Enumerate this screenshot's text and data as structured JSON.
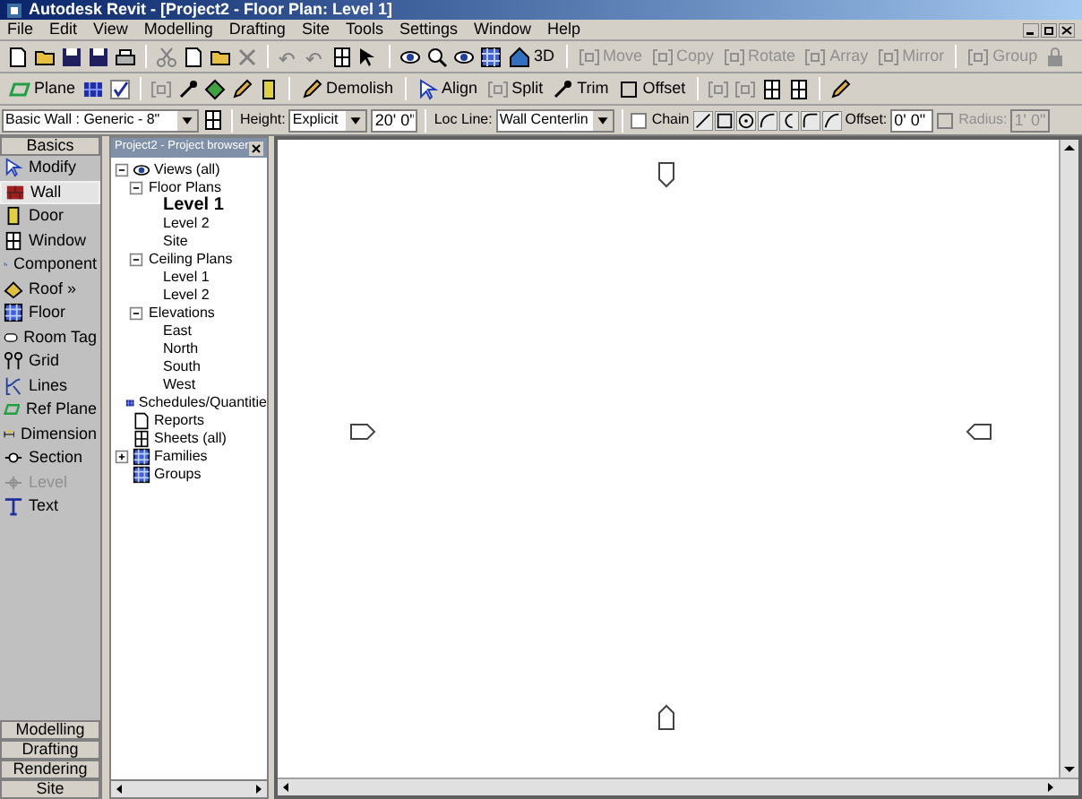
{
  "window": {
    "title": "Autodesk Revit - [Project2 - Floor Plan: Level 1]"
  },
  "menu": [
    "File",
    "Edit",
    "View",
    "Modelling",
    "Drafting",
    "Site",
    "Tools",
    "Settings",
    "Window",
    "Help"
  ],
  "toolbar_1": [
    {
      "label": "3D",
      "disabled": false
    },
    {
      "label": "Move",
      "disabled": true
    },
    {
      "label": "Copy",
      "disabled": true
    },
    {
      "label": "Rotate",
      "disabled": true
    },
    {
      "label": "Array",
      "disabled": true
    },
    {
      "label": "Mirror",
      "disabled": true
    },
    {
      "label": "Group",
      "disabled": true
    }
  ],
  "toolbar_2": [
    {
      "label": "Plane"
    },
    {
      "label": "Demolish"
    },
    {
      "label": "Align"
    },
    {
      "label": "Split"
    },
    {
      "label": "Trim"
    },
    {
      "label": "Offset"
    }
  ],
  "options_bar": {
    "type": "Basic Wall : Generic - 8\"",
    "height_label": "Height:",
    "height_mode": "Explicit",
    "height_value": "20' 0\"",
    "loc_line_label": "Loc Line:",
    "loc_line": "Wall Centerlin",
    "chain": {
      "label": "Chain",
      "checked": false
    },
    "offset_label": "Offset:",
    "offset_value": "0' 0\"",
    "radius": {
      "label": "Radius:",
      "checked": false,
      "disabled": true,
      "value": "1' 0\""
    }
  },
  "palette": {
    "title": "Basics",
    "items": [
      {
        "label": "Modify",
        "selected": false,
        "disabled": false
      },
      {
        "label": "Wall",
        "selected": true,
        "disabled": false
      },
      {
        "label": "Door",
        "selected": false,
        "disabled": false
      },
      {
        "label": "Window",
        "selected": false,
        "disabled": false
      },
      {
        "label": "Component",
        "selected": false,
        "disabled": false
      },
      {
        "label": "Roof »",
        "selected": false,
        "disabled": false
      },
      {
        "label": "Floor",
        "selected": false,
        "disabled": false
      },
      {
        "label": "Room Tag",
        "selected": false,
        "disabled": false
      },
      {
        "label": "Grid",
        "selected": false,
        "disabled": false
      },
      {
        "label": "Lines",
        "selected": false,
        "disabled": false
      },
      {
        "label": "Ref Plane",
        "selected": false,
        "disabled": false
      },
      {
        "label": "Dimension",
        "selected": false,
        "disabled": false
      },
      {
        "label": "Section",
        "selected": false,
        "disabled": false
      },
      {
        "label": "Level",
        "selected": false,
        "disabled": true
      },
      {
        "label": "Text",
        "selected": false,
        "disabled": false
      }
    ],
    "tabs": [
      {
        "label": "Modelling"
      },
      {
        "label": "Drafting"
      },
      {
        "label": "Rendering"
      },
      {
        "label": "Site"
      }
    ]
  },
  "project_browser": {
    "title": "Project2 - Project browser",
    "tree": [
      {
        "label": "Views (all)",
        "expanded": true,
        "children": [
          {
            "label": "Floor Plans",
            "expanded": true,
            "children": [
              {
                "label": "Level 1",
                "current": true
              },
              {
                "label": "Level 2",
                "current": false
              },
              {
                "label": "Site",
                "current": false
              }
            ]
          },
          {
            "label": "Ceiling Plans",
            "expanded": true,
            "children": [
              {
                "label": "Level 1",
                "current": false
              },
              {
                "label": "Level 2",
                "current": false
              }
            ]
          },
          {
            "label": "Elevations",
            "expanded": true,
            "children": [
              {
                "label": "East",
                "current": false
              },
              {
                "label": "North",
                "current": false
              },
              {
                "label": "South",
                "current": false
              },
              {
                "label": "West",
                "current": false
              }
            ]
          }
        ]
      },
      {
        "label": "Schedules/Quantitie"
      },
      {
        "label": "Reports"
      },
      {
        "label": "Sheets (all)"
      },
      {
        "label": "Families",
        "expanded": false
      },
      {
        "label": "Groups"
      }
    ]
  }
}
